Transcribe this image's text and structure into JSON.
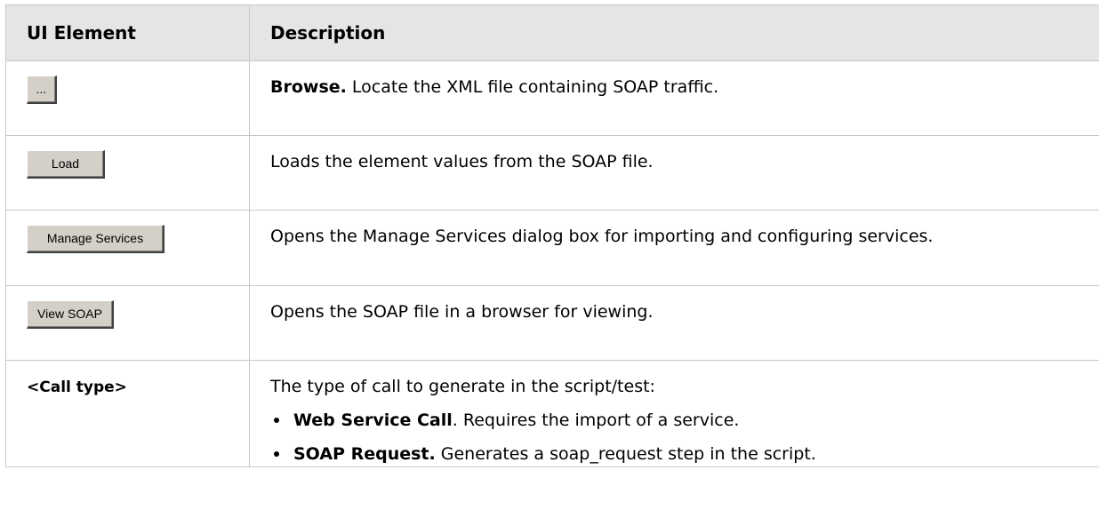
{
  "header": {
    "col1": "UI Element",
    "col2": "Description"
  },
  "rows": [
    {
      "button_label": "...",
      "desc_bold": "Browse.",
      "desc_text": " Locate the XML file containing SOAP traffic."
    },
    {
      "button_label": "Load",
      "desc_text": "Loads the element values from the SOAP file."
    },
    {
      "button_label": "Manage Services",
      "desc_text": "Opens the Manage Services dialog box for importing and configuring services."
    },
    {
      "button_label": "View SOAP",
      "desc_text": "Opens the SOAP file in a browser for viewing."
    },
    {
      "element_label": "<Call type>",
      "desc_text": "The type of call to generate in the script/test:",
      "bullets": [
        {
          "bold": "Web Service Call",
          "text": ". Requires the import of a service."
        },
        {
          "bold": "SOAP Request.",
          "text": " Generates a soap_request step in the script."
        }
      ]
    }
  ]
}
